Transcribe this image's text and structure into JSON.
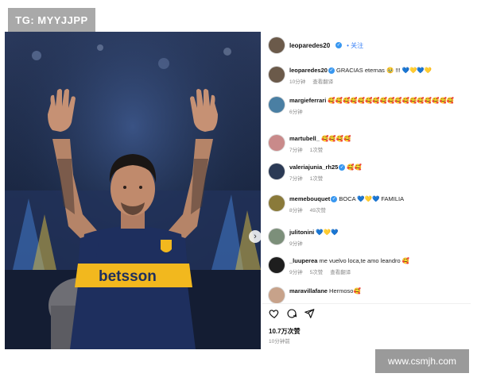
{
  "watermark_top": "TG: MYYJJPP",
  "watermark_bottom": "www.csmjh.com",
  "photo": {
    "jersey_sponsor": "betsson"
  },
  "header": {
    "username": "leoparedes20",
    "follow_label": "关注"
  },
  "comments": [
    {
      "user": "leoparedes20",
      "verified": true,
      "text": "GRACIAS eternas 🥹 !!! 💙💛💙💛",
      "time": "10分钟",
      "reply": "",
      "translate": "查看翻译",
      "avatar": "#6b5a4a"
    },
    {
      "user": "margieferrari",
      "verified": false,
      "text": "🥰🥰🥰🥰🥰🥰🥰🥰🥰🥰🥰🥰🥰🥰🥰🥰🥰",
      "time": "6分钟",
      "reply": "",
      "translate": "",
      "avatar": "#4a7fa3"
    },
    {
      "user": "martubell_",
      "verified": false,
      "text": "🥰🥰🥰🥰",
      "time": "7分钟",
      "reply": "1次赞",
      "translate": "",
      "avatar": "#c98a8a"
    },
    {
      "user": "valeriajunia_rh25",
      "verified": true,
      "text": "🥰🥰",
      "time": "7分钟",
      "reply": "1次赞",
      "translate": "",
      "avatar": "#2b3a55"
    },
    {
      "user": "memebouquet",
      "verified": true,
      "text": "BOCA 💙💛💙 FAMILIA",
      "time": "8分钟",
      "reply": "49次赞",
      "translate": "",
      "avatar": "#8a7a3a"
    },
    {
      "user": "julitonini",
      "verified": false,
      "text": "💙💛💙",
      "time": "9分钟",
      "reply": "",
      "translate": "",
      "avatar": "#7c8f7a"
    },
    {
      "user": "_luuperea",
      "verified": false,
      "text": "me vuelvo loca,te amo leandro 🥰",
      "time": "9分钟",
      "reply": "5次赞",
      "translate": "查看翻译",
      "avatar": "#1e1e1e"
    },
    {
      "user": "maravillafane",
      "verified": false,
      "text": "Hermoso🥰",
      "time": "",
      "reply": "",
      "translate": "",
      "avatar": "#c7a28a"
    }
  ],
  "footer": {
    "likes": "10.7万次赞",
    "time": "10分钟前"
  }
}
